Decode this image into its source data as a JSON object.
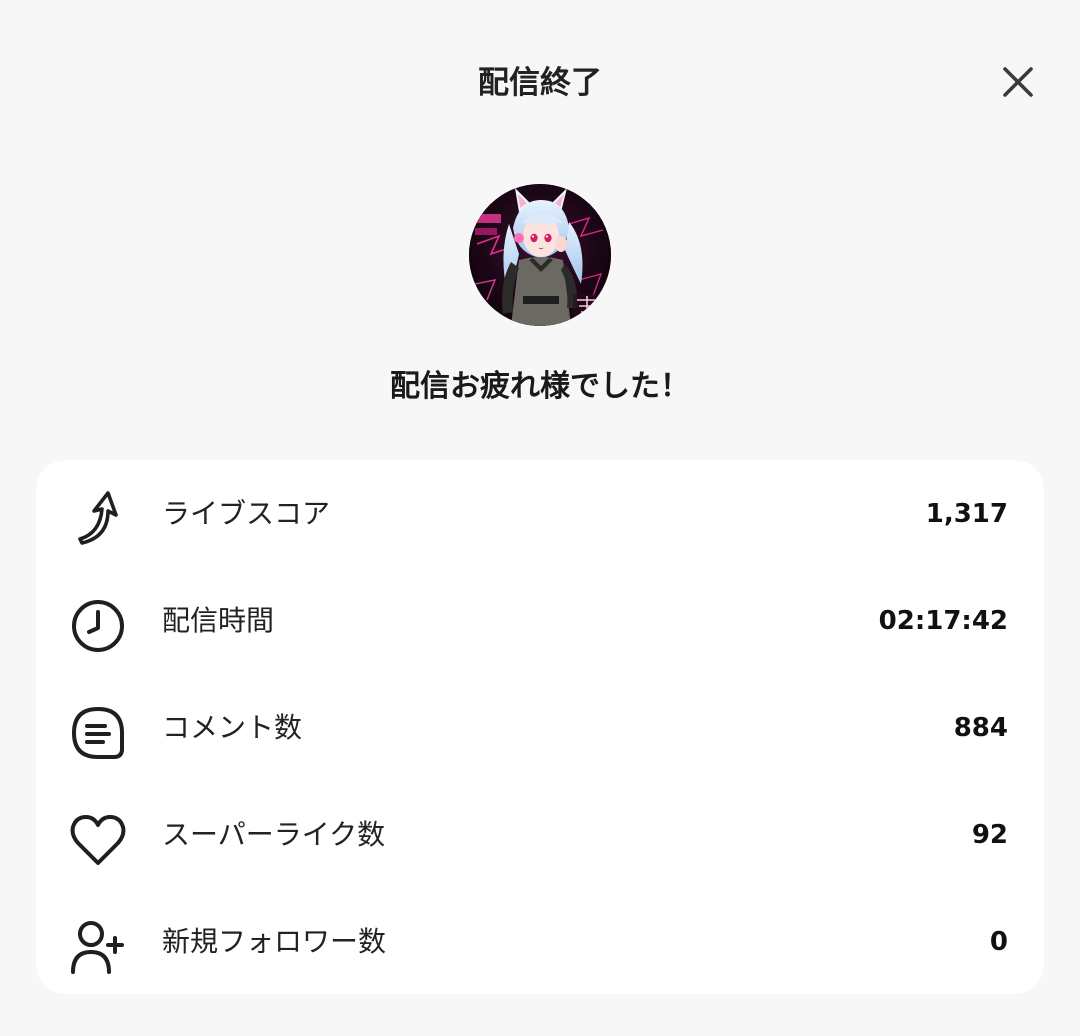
{
  "header": {
    "title": "配信終了",
    "close_icon": "close-icon"
  },
  "avatar": {
    "description_icon": "streamer-avatar"
  },
  "subtitle": "配信お疲れ様でした！",
  "stats": [
    {
      "icon": "rising-arrow-icon",
      "label": "ライブスコア",
      "value": "1,317"
    },
    {
      "icon": "clock-icon",
      "label": "配信時間",
      "value": "02:17:42"
    },
    {
      "icon": "comment-icon",
      "label": "コメント数",
      "value": "884"
    },
    {
      "icon": "heart-icon",
      "label": "スーパーライク数",
      "value": "92"
    },
    {
      "icon": "add-user-icon",
      "label": "新規フォロワー数",
      "value": "0"
    }
  ],
  "colors": {
    "background": "#f7f7f7",
    "card": "#ffffff",
    "text": "#1a1a1a",
    "icon_stroke": "#222222",
    "avatar_accent": "#e0288a"
  }
}
